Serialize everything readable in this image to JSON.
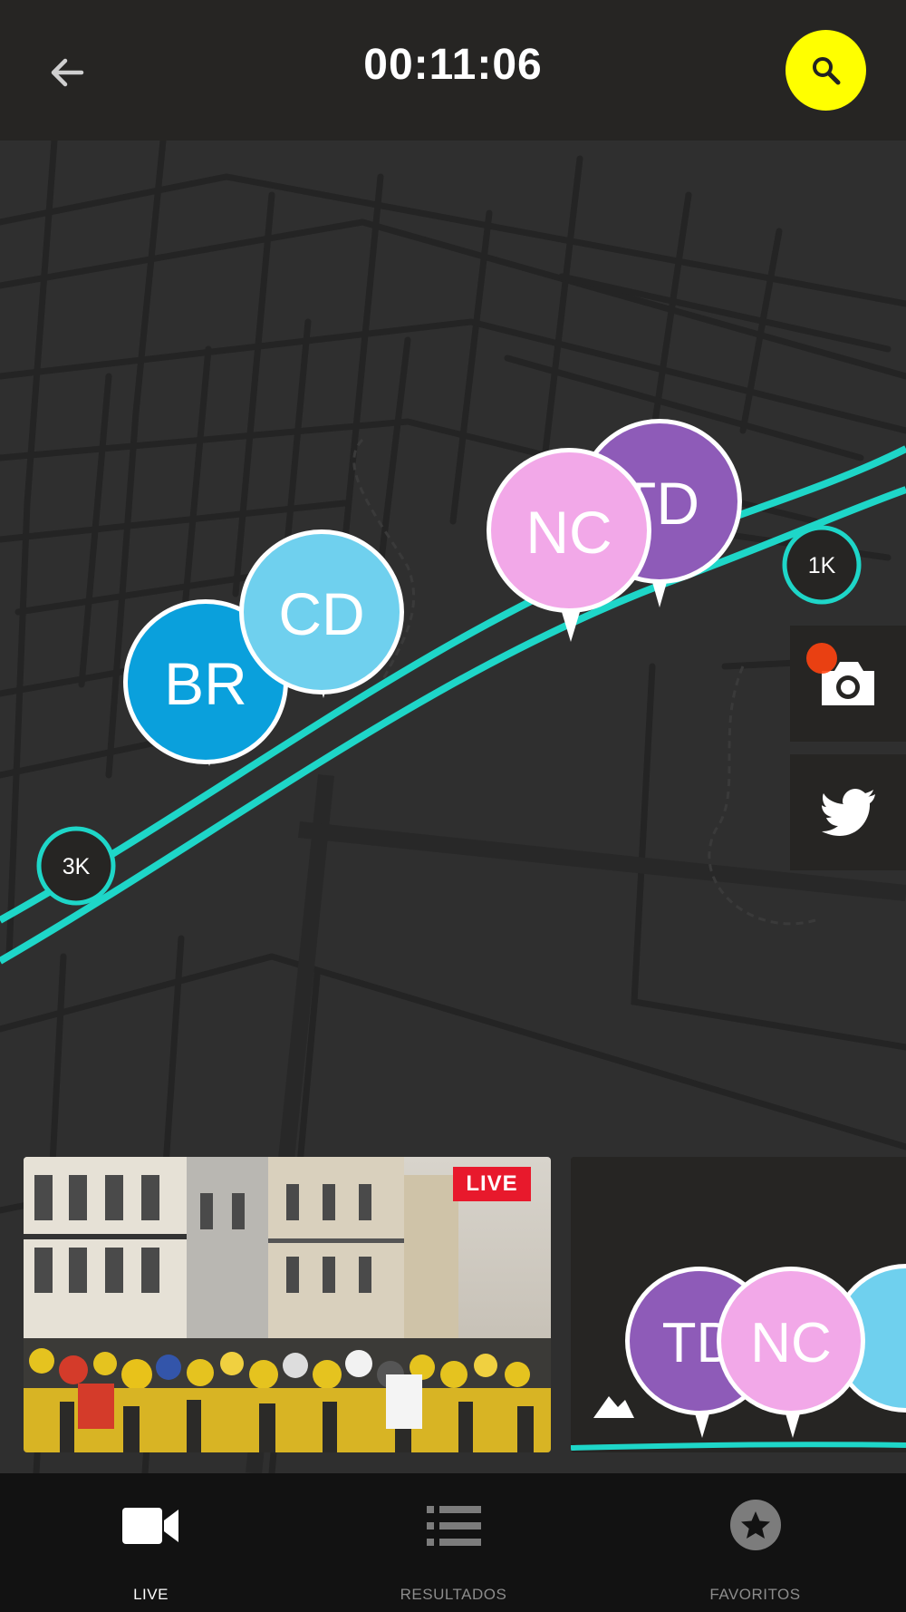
{
  "header": {
    "timer": "00:11:06"
  },
  "map": {
    "markers": [
      "1K",
      "3K"
    ],
    "runners": [
      "BR",
      "CD",
      "NC",
      "TD"
    ]
  },
  "live_card": {
    "badge": "LIVE"
  },
  "preview_card": {
    "runners": [
      "TD",
      "NC"
    ]
  },
  "nav": {
    "items": [
      {
        "label": "LIVE",
        "icon": "video-camera-icon",
        "active": true
      },
      {
        "label": "RESULTADOS",
        "icon": "list-icon",
        "active": false
      },
      {
        "label": "FAVORITOS",
        "icon": "star-icon",
        "active": false
      }
    ]
  },
  "colors": {
    "accent": "#ffff00",
    "route": "#1ed6c8",
    "runner_br": "#0aa0dc",
    "runner_cd": "#6fd0ee",
    "runner_nc": "#f2a8e8",
    "runner_td": "#8e5bb8",
    "live_red": "#e8192c"
  }
}
